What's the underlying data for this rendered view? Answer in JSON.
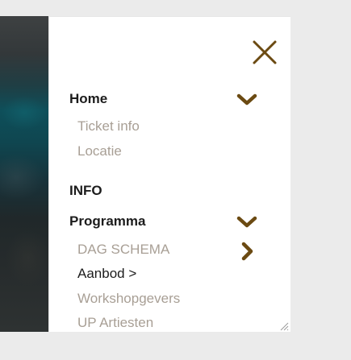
{
  "menu": {
    "close_label": "×",
    "items": [
      {
        "label": "Home"
      },
      {
        "label": "INFO"
      },
      {
        "label": "Programma"
      }
    ],
    "home_sub": [
      {
        "label": "Ticket info"
      },
      {
        "label": "Locatie"
      }
    ],
    "programma_sub": [
      {
        "label": "DAG SCHEMA"
      },
      {
        "label": "Aanbod >"
      },
      {
        "label": "Workshopgevers"
      },
      {
        "label": "UP Artiesten"
      }
    ]
  },
  "colors": {
    "accent": "#6b4a12",
    "text_dark": "#1c1c1c",
    "text_muted": "#a89f95",
    "panel_bg": "#ffffff",
    "page_bg": "#ebebeb"
  },
  "icons": {
    "close": "close-icon",
    "expand": "chevron-down-icon",
    "next": "chevron-right-icon"
  }
}
